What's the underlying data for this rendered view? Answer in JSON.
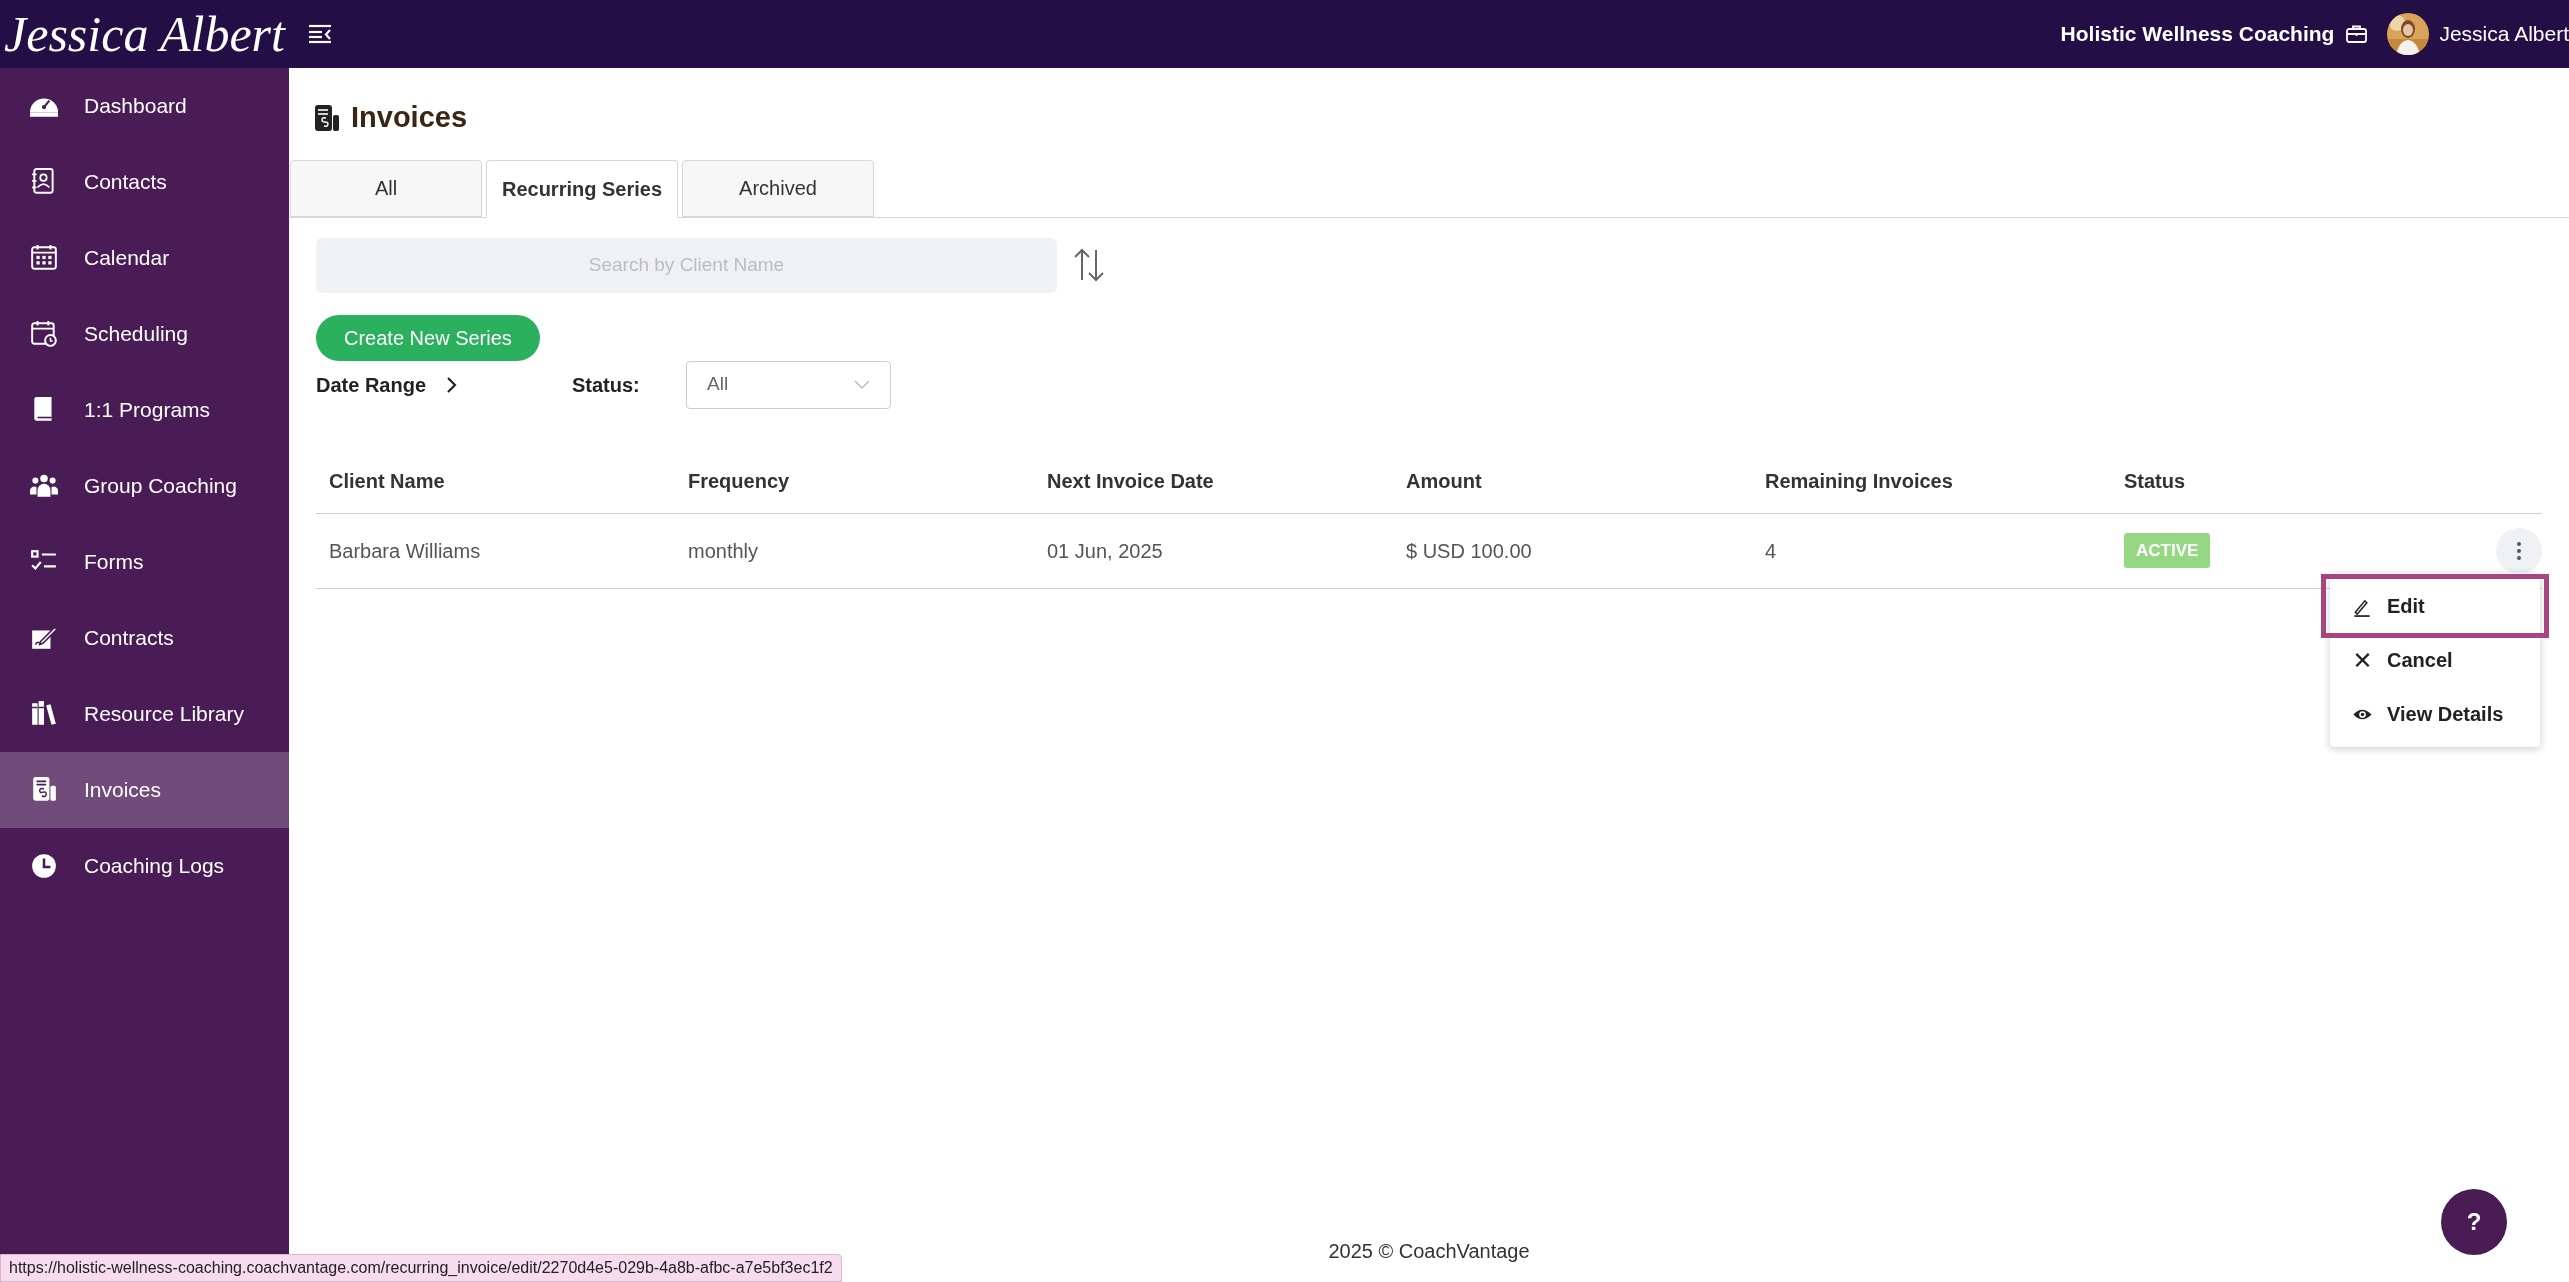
{
  "header": {
    "logo": "Jessica Albert",
    "workspace": "Holistic Wellness Coaching",
    "user": "Jessica Albert"
  },
  "sidebar": {
    "items": [
      {
        "label": "Dashboard",
        "selected": false
      },
      {
        "label": "Contacts",
        "selected": false
      },
      {
        "label": "Calendar",
        "selected": false
      },
      {
        "label": "Scheduling",
        "selected": false
      },
      {
        "label": "1:1 Programs",
        "selected": false
      },
      {
        "label": "Group Coaching",
        "selected": false
      },
      {
        "label": "Forms",
        "selected": false
      },
      {
        "label": "Contracts",
        "selected": false
      },
      {
        "label": "Resource Library",
        "selected": false
      },
      {
        "label": "Invoices",
        "selected": true
      },
      {
        "label": "Coaching Logs",
        "selected": false
      }
    ]
  },
  "page_title": "Invoices",
  "tabs": [
    {
      "label": "All",
      "selected": false
    },
    {
      "label": "Recurring Series",
      "selected": true
    },
    {
      "label": "Archived",
      "selected": false
    }
  ],
  "search": {
    "placeholder": "Search by Client Name"
  },
  "create_button": "Create New Series",
  "filters": {
    "date_range": "Date Range",
    "status_label": "Status:",
    "status_value": "All"
  },
  "table": {
    "columns": [
      "Client Name",
      "Frequency",
      "Next Invoice Date",
      "Amount",
      "Remaining Invoices",
      "Status"
    ],
    "rows": [
      {
        "cells": [
          "Barbara Williams",
          "monthly",
          "01 Jun, 2025",
          "$ USD 100.00",
          "4"
        ],
        "status": "ACTIVE"
      }
    ]
  },
  "row_menu": {
    "items": [
      {
        "label": "Edit",
        "highlighted": true
      },
      {
        "label": "Cancel",
        "highlighted": false
      },
      {
        "label": "View Details",
        "highlighted": false
      }
    ]
  },
  "footer": "2025 © CoachVantage",
  "help_button": "?",
  "status_url": "https://holistic-wellness-coaching.coachvantage.com/recurring_invoice/edit/2270d4e5-029b-4a8b-afbc-a7e5bf3ec1f2"
}
